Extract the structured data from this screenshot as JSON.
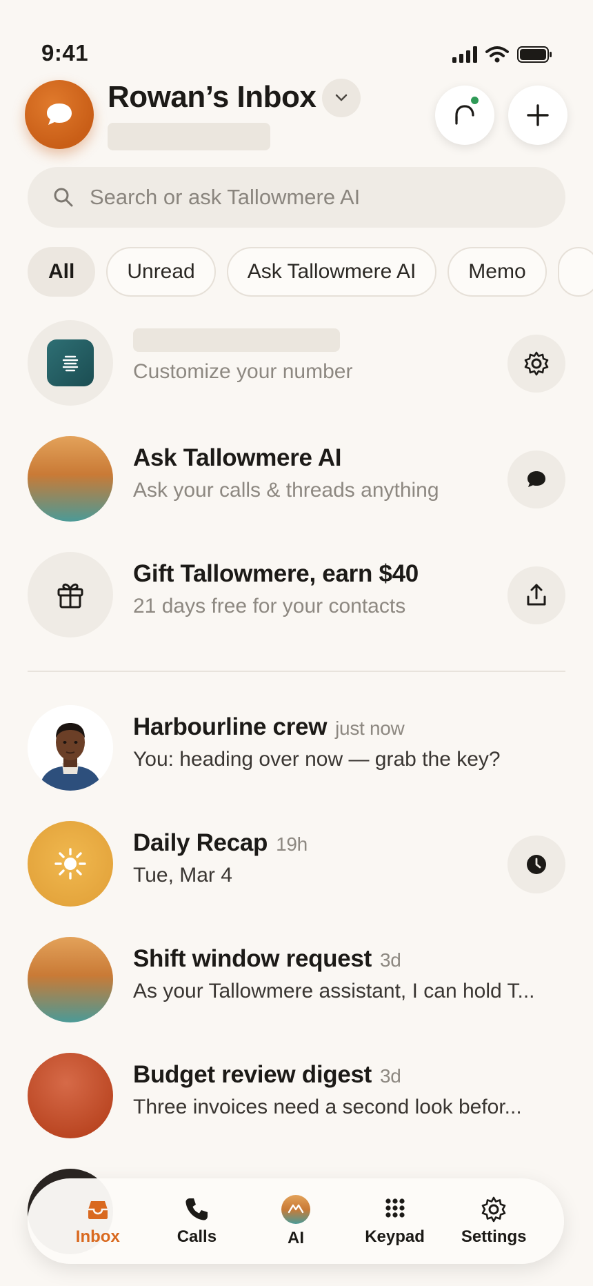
{
  "status": {
    "time": "9:41"
  },
  "header": {
    "title": "Rowan’s Inbox"
  },
  "search": {
    "placeholder": "Search or ask Tallowmere AI"
  },
  "filters": [
    "All",
    "Unread",
    "Ask Tallowmere AI",
    "Memo"
  ],
  "pinned": [
    {
      "title": "",
      "subtitle": "Customize your number",
      "action_icon": "gear-icon"
    },
    {
      "title": "Ask Tallowmere AI",
      "subtitle": "Ask your calls & threads anything",
      "action_icon": "chat-bubble-icon"
    },
    {
      "title": "Gift Tallowmere, earn $40",
      "subtitle": "21 days free for your contacts",
      "action_icon": "share-icon"
    }
  ],
  "threads": [
    {
      "title": "Harbourline crew",
      "time": "just now",
      "preview": "You: heading over now — grab the key?"
    },
    {
      "title": "Daily Recap",
      "time": "19h",
      "preview": "Tue, Mar 4",
      "action_icon": "clock-icon"
    },
    {
      "title": "Shift window request",
      "time": "3d",
      "preview": "As your Tallowmere assistant, I can hold T..."
    },
    {
      "title": "Budget review digest",
      "time": "3d",
      "preview": "Three invoices need a second look befor..."
    }
  ],
  "tabbar": {
    "active": "Inbox",
    "items": [
      "Inbox",
      "Calls",
      "AI",
      "Keypad",
      "Settings"
    ]
  },
  "colors": {
    "accent": "#d9691f",
    "background": "#faf7f3",
    "online": "#2f9a57"
  }
}
